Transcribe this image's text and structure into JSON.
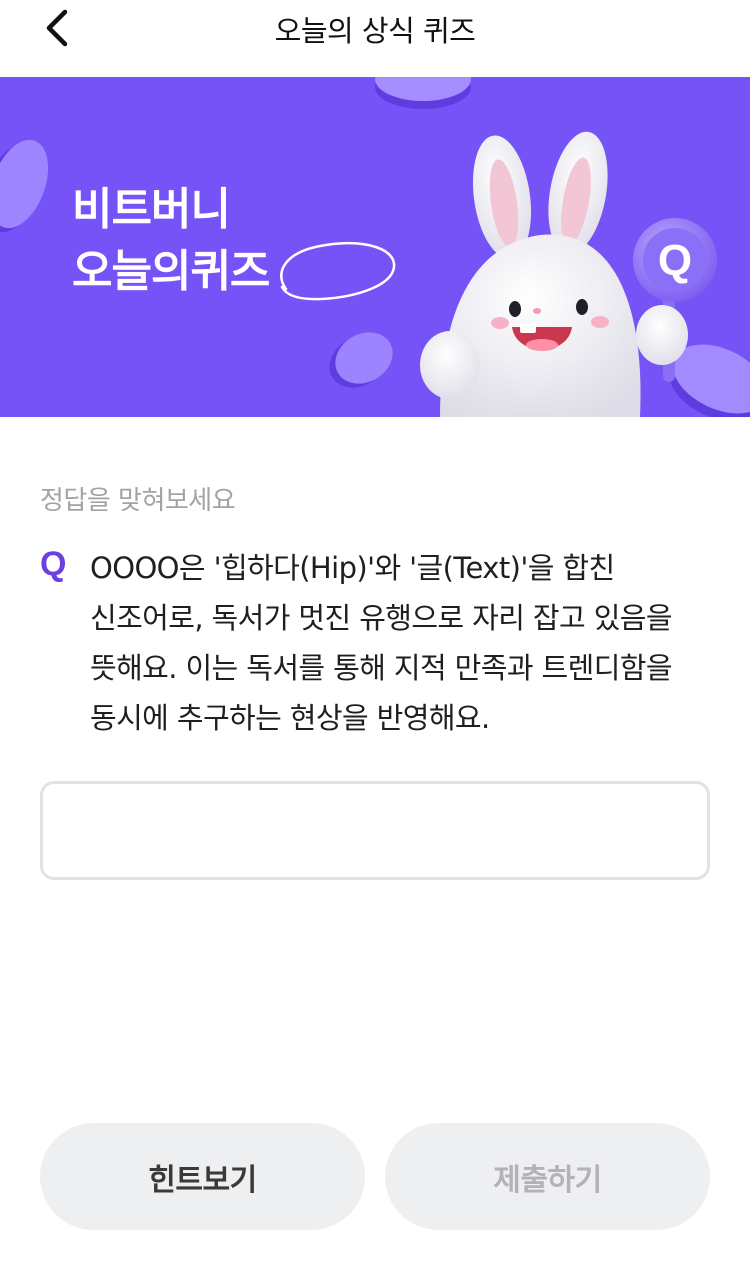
{
  "header": {
    "title": "오늘의 상식 퀴즈",
    "back_icon": "chevron-left-icon"
  },
  "banner": {
    "line1": "비트버니",
    "line2_prefix": "오늘의",
    "line2_highlight": "퀴즈",
    "sign_letter": "Q",
    "background_color": "#7653f6"
  },
  "quiz": {
    "prompt": "정답을 맞혀보세요",
    "q_mark": "Q",
    "question": "OOOO은 '힙하다(Hip)'와 '글(Text)'을 합친 신조어로, 독서가 멋진 유행으로 자리 잡고 있음을 뜻해요. 이는 독서를 통해 지적 만족과 트렌디함을 동시에 추구하는 현상을 반영해요.",
    "answer_value": "",
    "answer_placeholder": ""
  },
  "buttons": {
    "hint_label": "힌트보기",
    "submit_label": "제출하기"
  },
  "colors": {
    "accent": "#6b3fe0",
    "button_bg": "#eeeff1",
    "disabled_text": "#b3b3b6"
  }
}
